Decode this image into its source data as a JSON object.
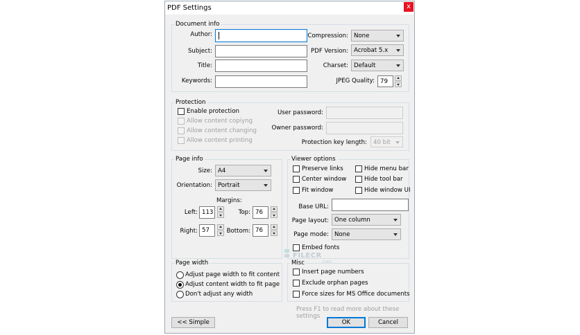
{
  "window": {
    "title": "PDF Settings",
    "close": "x"
  },
  "doc": {
    "group": "Document info",
    "author": "Author:",
    "subject": "Subject:",
    "title": "Title:",
    "keywords": "Keywords:",
    "author_value": "",
    "subject_value": "",
    "title_value": "",
    "keywords_value": "",
    "compression": "Compression:",
    "compression_value": "None",
    "pdf_version": "PDF Version:",
    "pdf_version_value": "Acrobat 5.x",
    "charset": "Charset:",
    "charset_value": "Default",
    "jpeg": "JPEG Quality:",
    "jpeg_value": "79"
  },
  "protection": {
    "group": "Protection",
    "enable": "Enable protection",
    "copy": "Allow content copiyng",
    "change": "Allow content changing",
    "print": "Allow content printing",
    "user_pw": "User password:",
    "owner_pw": "Owner password:",
    "keylen": "Protection key length:",
    "keylen_value": "40 bit"
  },
  "page": {
    "group": "Page info",
    "size": "Size:",
    "size_value": "A4",
    "orientation": "Orientation:",
    "orientation_value": "Portrait",
    "margins": "Margins:",
    "left": "Left:",
    "left_value": "113",
    "top": "Top:",
    "top_value": "76",
    "right": "Right:",
    "right_value": "57",
    "bottom": "Bottom:",
    "bottom_value": "76"
  },
  "viewer": {
    "group": "Viewer options",
    "preserve": "Preserve links",
    "hide_menu": "Hide menu bar",
    "center": "Center window",
    "hide_tool": "Hide tool bar",
    "fit": "Fit window",
    "hide_ui": "Hide window UI",
    "base_url": "Base URL:",
    "base_url_value": "",
    "layout": "Page layout:",
    "layout_value": "One column",
    "mode": "Page mode:",
    "mode_value": "None",
    "embed": "Embed fonts"
  },
  "width": {
    "group": "Page width",
    "opt1": "Adjust page width to fit content",
    "opt2": "Adjust content width to fit page",
    "opt3": "Don't adjust any width",
    "selected": 2
  },
  "misc": {
    "group": "Misc",
    "insert": "Insert page numbers",
    "exclude": "Exclude orphan pages",
    "force": "Force sizes for MS Office documents"
  },
  "footer": {
    "hint": "Press F1 to read more about these settings",
    "simple": "<< Simple",
    "ok": "OK",
    "cancel": "Cancel"
  },
  "watermark": {
    "brand": "FILECR",
    ".com": ".com"
  },
  "colors": {
    "accent": "#0078d7",
    "close": "#e81123"
  }
}
